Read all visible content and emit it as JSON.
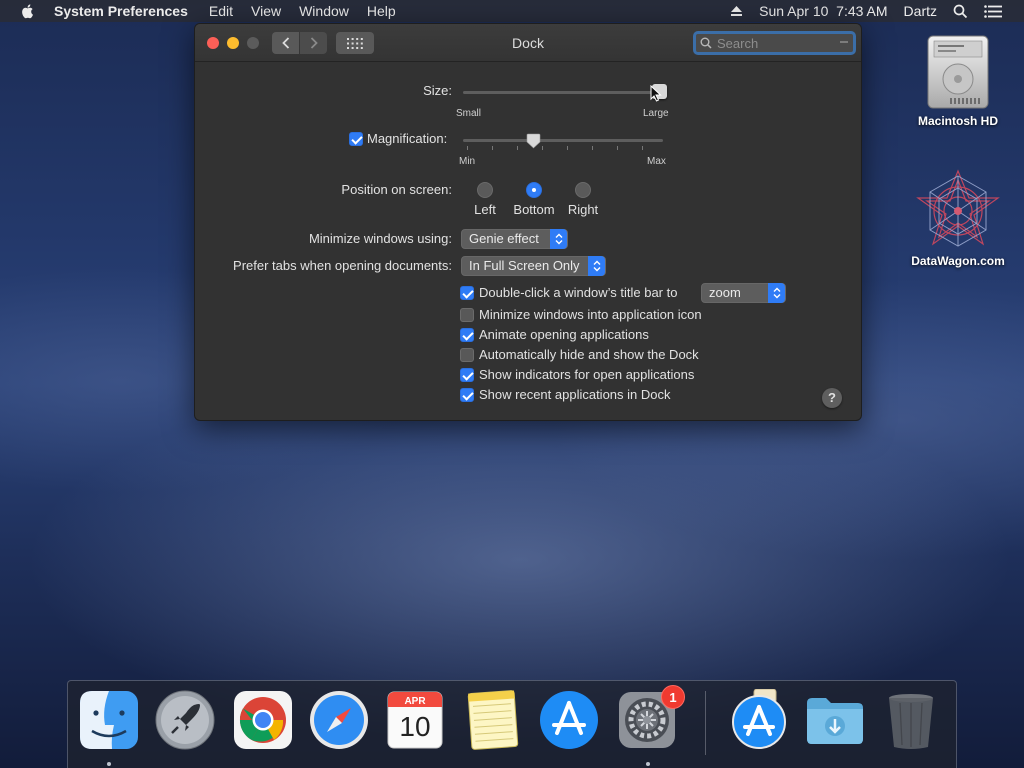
{
  "menubar": {
    "app_name": "System Preferences",
    "items": [
      "Edit",
      "View",
      "Window",
      "Help"
    ],
    "clock": "Sun Apr 10  7:43 AM",
    "user": "Dartz"
  },
  "window": {
    "title": "Dock",
    "search": {
      "placeholder": "Search",
      "value": ""
    },
    "size": {
      "label": "Size:",
      "min_label": "Small",
      "max_label": "Large",
      "value_fraction": 0.98
    },
    "magnification": {
      "label": "Magnification:",
      "checked": true,
      "min_label": "Min",
      "max_label": "Max",
      "value_fraction": 0.35
    },
    "position": {
      "label": "Position on screen:",
      "options": [
        "Left",
        "Bottom",
        "Right"
      ],
      "selected": "Bottom"
    },
    "minimize_using": {
      "label": "Minimize windows using:",
      "value": "Genie effect"
    },
    "prefer_tabs": {
      "label": "Prefer tabs when opening documents:",
      "value": "In Full Screen Only"
    },
    "options": [
      {
        "label": "Double-click a window’s title bar to",
        "checked": true,
        "popup": "zoom"
      },
      {
        "label": "Minimize windows into application icon",
        "checked": false
      },
      {
        "label": "Animate opening applications",
        "checked": true
      },
      {
        "label": "Automatically hide and show the Dock",
        "checked": false
      },
      {
        "label": "Show indicators for open applications",
        "checked": true
      },
      {
        "label": "Show recent applications in Dock",
        "checked": true
      }
    ],
    "help_label": "?"
  },
  "desktop": {
    "icons": [
      {
        "name": "Macintosh HD"
      },
      {
        "name": "DataWagon.com"
      }
    ]
  },
  "dock": {
    "calendar_month": "APR",
    "calendar_day": "10",
    "system_prefs_badge": "1"
  }
}
